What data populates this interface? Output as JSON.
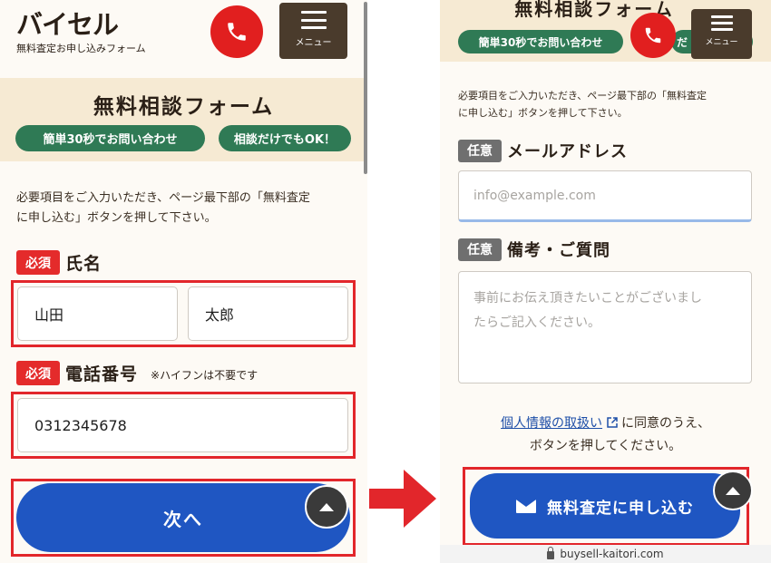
{
  "left": {
    "logo": "バイセル",
    "logo_sub": "無料査定お申し込みフォーム",
    "menu_label": "メニュー",
    "form_title": "無料相談フォーム",
    "pill_1": "簡単30秒でお問い合わせ",
    "pill_2": "相談だけでもOK！",
    "intro_line1": "必要項目をご入力いただき、ページ最下部の「無料査定",
    "intro_line2": "に申し込む」ボタンを押して下さい。",
    "name_badge": "必須",
    "name_label": "氏名",
    "last_name_value": "山田",
    "first_name_value": "太郎",
    "phone_badge": "必須",
    "phone_label": "電話番号",
    "phone_note": "※ハイフンは不要です",
    "phone_value": "0312345678",
    "next_button": "次へ"
  },
  "right": {
    "form_title": "無料相談フォーム",
    "pill_1": "簡単30秒でお問い合わせ",
    "pill_2_partial": "だ",
    "menu_label": "メニュー",
    "intro_line1": "必要項目をご入力いただき、ページ最下部の「無料査定",
    "intro_line2": "に申し込む」ボタンを押して下さい。",
    "email_badge": "任意",
    "email_label": "メールアドレス",
    "email_placeholder": "info@example.com",
    "notes_badge": "任意",
    "notes_label": "備考・ご質問",
    "notes_placeholder_line1": "事前にお伝え頂きたいことがございまし",
    "notes_placeholder_line2": "たらご記入ください。",
    "privacy_link": "個人情報の取扱い",
    "consent_tail": "に同意のうえ、",
    "consent_line2": "ボタンを押してください。",
    "submit_button": "無料査定に申し込む",
    "url": "buysell-kaitori.com"
  },
  "colors": {
    "brand_red": "#e11f1f",
    "button_blue": "#1f56c2",
    "pill_green": "#2f7a55",
    "banner_beige": "#f6ead3",
    "highlight_red": "#e2262b"
  },
  "icons": [
    "phone-icon",
    "menu-icon",
    "scroll-top-icon",
    "arrow-right-icon",
    "mail-icon",
    "external-link-icon",
    "lock-icon"
  ]
}
